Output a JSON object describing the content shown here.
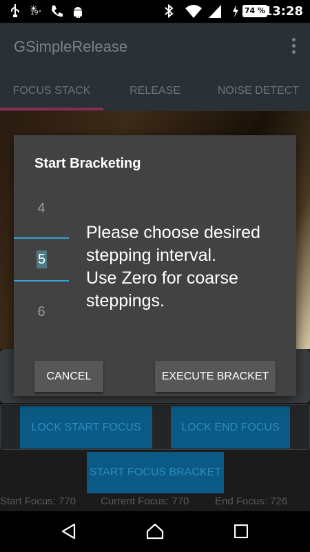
{
  "status_bar": {
    "temperature": "19°",
    "battery": "74 %",
    "time": "13:28"
  },
  "app": {
    "title": "GSimpleRelease"
  },
  "tabs": [
    {
      "label": "FOCUS STACK",
      "selected": true
    },
    {
      "label": "RELEASE",
      "selected": false
    },
    {
      "label": "NOISE DETECT",
      "selected": false
    }
  ],
  "controls": {
    "lock_start_focus": "LOCK START FOCUS",
    "lock_end_focus": "LOCK END FOCUS",
    "start_focus_bracket": "START FOCUS BRACKET"
  },
  "focus_info": {
    "start": "Start Focus: 770",
    "current": "Current Focus: 770",
    "end": "End Focus: 726"
  },
  "dialog": {
    "title": "Start Bracketing",
    "picker": {
      "prev": "4",
      "selected": "5",
      "next": "6"
    },
    "message": "Please choose desired stepping interval.\nUse Zero for coarse steppings.",
    "cancel_label": "CANCEL",
    "execute_label": "EXECUTE BRACKET"
  },
  "colors": {
    "accent": "#3aa3d6",
    "tab_indicator": "#8a2c4d",
    "button_blue": "#0a5a85"
  }
}
